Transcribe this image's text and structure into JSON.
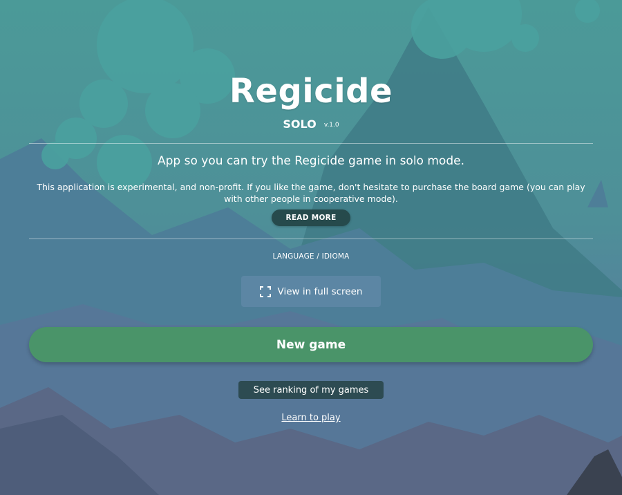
{
  "header": {
    "title": "Regicide",
    "subtitle": "SOLO",
    "version": "v.1.0"
  },
  "intro": {
    "tagline": "App so you can try the Regicide game in solo mode.",
    "disclaimer": "This application is experimental, and non-profit. If you like the game, don't hesitate to purchase the board game (you can play with other people in cooperative mode).",
    "read_more_label": "READ MORE"
  },
  "settings": {
    "language_label": "LANGUAGE / IDIOMA",
    "fullscreen_label": "View in full screen",
    "fullscreen_icon": "fullscreen-icon"
  },
  "actions": {
    "new_game_label": "New game",
    "ranking_label": "See ranking of my games",
    "learn_label": "Learn to play"
  },
  "colors": {
    "new_game_button": "#4a9469",
    "read_more_button": "#264a4c",
    "ranking_button": "#2d4b52",
    "sky_top": "#4b9a98",
    "sky_bottom": "#5a7f9c"
  }
}
